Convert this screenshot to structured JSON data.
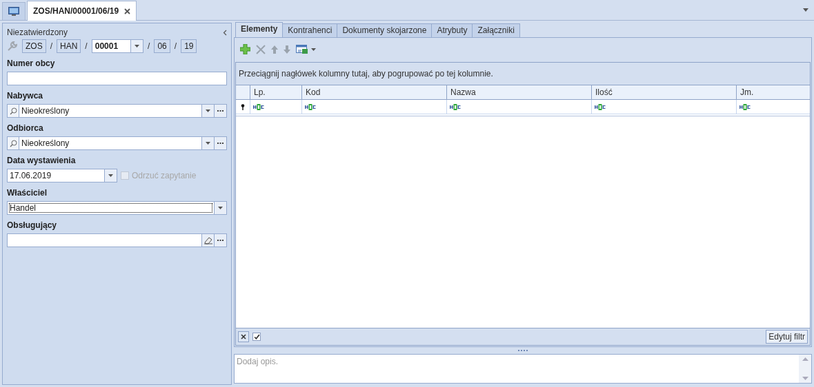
{
  "document_tabs": [
    {
      "kind": "home",
      "selected": false
    },
    {
      "kind": "document",
      "title": "ZOS/HAN/00001/06/19",
      "selected": true
    }
  ],
  "header": {
    "status": "Niezatwierdzony",
    "number_parts": [
      {
        "kind": "fixed",
        "value": "ZOS"
      },
      {
        "kind": "fixed",
        "separator": "/",
        "value": "HAN"
      },
      {
        "kind": "combo",
        "separator": "/",
        "value": "00001"
      },
      {
        "kind": "fixed",
        "separator": "/",
        "value": "06"
      },
      {
        "kind": "fixed",
        "separator": "/",
        "value": "19"
      }
    ]
  },
  "fields": [
    {
      "kind": "text",
      "label": "Numer obcy"
    },
    {
      "kind": "lookup",
      "label": "Nabywca",
      "value": "Nieokreślony"
    },
    {
      "kind": "lookup",
      "label": "Odbiorca",
      "value": "Nieokreślony"
    },
    {
      "kind": "date",
      "label": "Data wystawienia",
      "value": "17.06.2019",
      "option": {
        "label": "Odrzuć zapytanie",
        "checked": false,
        "disabled": true
      }
    },
    {
      "kind": "combo",
      "label": "Właściciel",
      "value": "Handel",
      "focused": true
    },
    {
      "kind": "picker",
      "label": "Obsługujący"
    }
  ],
  "tabs": [
    {
      "label": "Elementy",
      "selected": true
    },
    {
      "label": "Kontrahenci",
      "selected": false
    },
    {
      "label": "Dokumenty skojarzone",
      "selected": false
    },
    {
      "label": "Atrybuty",
      "selected": false
    },
    {
      "label": "Załączniki",
      "selected": false
    }
  ],
  "toolbar": [
    {
      "kind": "add",
      "disabled": false
    },
    {
      "kind": "delete",
      "disabled": true
    },
    {
      "kind": "up",
      "disabled": true
    },
    {
      "kind": "down",
      "disabled": true
    },
    {
      "kind": "export",
      "disabled": false
    }
  ],
  "table": {
    "group_hint": "Przeciągnij nagłówek kolumny tutaj, aby pogrupować po tej kolumnie.",
    "columns": [
      "Lp.",
      "Kod",
      "Nazwa",
      "Ilość",
      "Jm."
    ]
  },
  "filter_bar": {
    "filter_enabled": true,
    "button": "Edytuj filtr"
  },
  "description": {
    "placeholder": "Dodaj opis."
  }
}
